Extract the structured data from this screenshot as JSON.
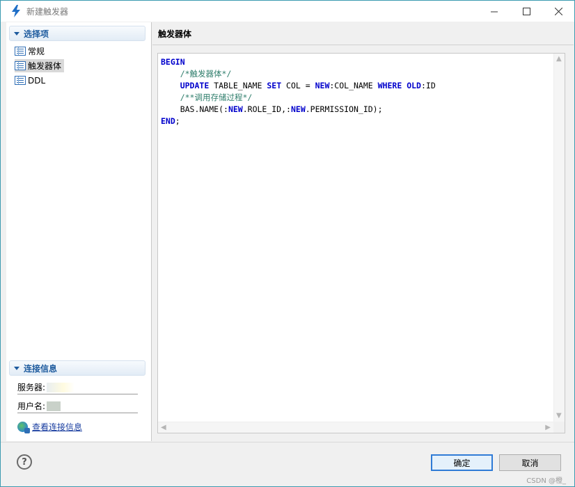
{
  "window": {
    "title": "新建触发器"
  },
  "left": {
    "options_header": "选择项",
    "items": [
      {
        "label": "常规",
        "selected": false
      },
      {
        "label": "触发器体",
        "selected": true
      },
      {
        "label": "DDL",
        "selected": false
      }
    ],
    "connection_header": "连接信息",
    "server_label": "服务器:",
    "user_label": "用户名:",
    "view_connection_link": "查看连接信息"
  },
  "right": {
    "header": "触发器体",
    "code_lines": [
      [
        {
          "t": "BEGIN",
          "c": "kw"
        }
      ],
      [
        {
          "t": "    ",
          "c": "id"
        },
        {
          "t": "/*触发器体*/",
          "c": "cm"
        }
      ],
      [
        {
          "t": "    ",
          "c": "id"
        },
        {
          "t": "UPDATE",
          "c": "kw"
        },
        {
          "t": " TABLE_NAME ",
          "c": "id"
        },
        {
          "t": "SET",
          "c": "kw"
        },
        {
          "t": " COL = ",
          "c": "id"
        },
        {
          "t": "NEW",
          "c": "kw"
        },
        {
          "t": ":COL_NAME ",
          "c": "id"
        },
        {
          "t": "WHERE",
          "c": "kw"
        },
        {
          "t": " ",
          "c": "id"
        },
        {
          "t": "OLD",
          "c": "kw"
        },
        {
          "t": ":ID",
          "c": "id"
        }
      ],
      [
        {
          "t": "    ",
          "c": "id"
        },
        {
          "t": "/**调用存储过程*/",
          "c": "cm"
        }
      ],
      [
        {
          "t": "    BAS.NAME(:",
          "c": "id"
        },
        {
          "t": "NEW",
          "c": "kw"
        },
        {
          "t": ".ROLE_ID,:",
          "c": "id"
        },
        {
          "t": "NEW",
          "c": "kw"
        },
        {
          "t": ".PERMISSION_ID);",
          "c": "id"
        }
      ],
      [
        {
          "t": "END",
          "c": "kw"
        },
        {
          "t": ";",
          "c": "id"
        }
      ]
    ]
  },
  "footer": {
    "ok_label": "确定",
    "cancel_label": "取消",
    "watermark": "CSDN @橙_"
  },
  "colors": {
    "keyword": "#0000cc",
    "comment": "#2e7d6b",
    "link": "#1a3ea0",
    "primary_border": "#2f7bd6"
  }
}
